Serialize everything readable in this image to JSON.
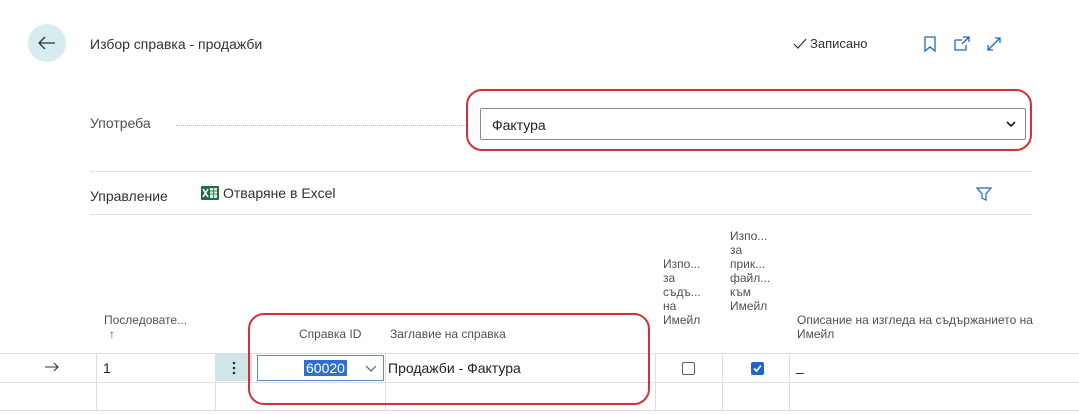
{
  "header": {
    "title": "Избор справка - продажби",
    "saved_label": "Записано"
  },
  "usage": {
    "label": "Употреба",
    "selected": "Фактура"
  },
  "toolbar": {
    "manage_label": "Управление",
    "excel_label": "Отваряне в Excel"
  },
  "table": {
    "columns": {
      "sequence": "Последовате...",
      "sort_arrow": "↑",
      "report_id": "Справка ID",
      "report_title": "Заглавие на справка",
      "use_body_1": "Изпо...",
      "use_body_2": "за",
      "use_body_3": "съдъ...",
      "use_body_4": "на",
      "use_body_5": "Имейл",
      "use_attach_1": "Изпо...",
      "use_attach_2": "за",
      "use_attach_3": "прик...",
      "use_attach_4": "файл...",
      "use_attach_5": "към",
      "use_attach_6": "Имейл",
      "layout_desc_1": "Описание на изгледа на съдържанието на",
      "layout_desc_2": "Имейл"
    },
    "rows": [
      {
        "sequence": "1",
        "report_id": "60020",
        "report_title": "Продажби - Фактура",
        "use_for_body": false,
        "use_for_attachment": true,
        "layout_description": "_"
      }
    ]
  },
  "colors": {
    "accent": "#1f66c8",
    "annotation": "#d62f35",
    "back_bg": "#d7ecee"
  }
}
